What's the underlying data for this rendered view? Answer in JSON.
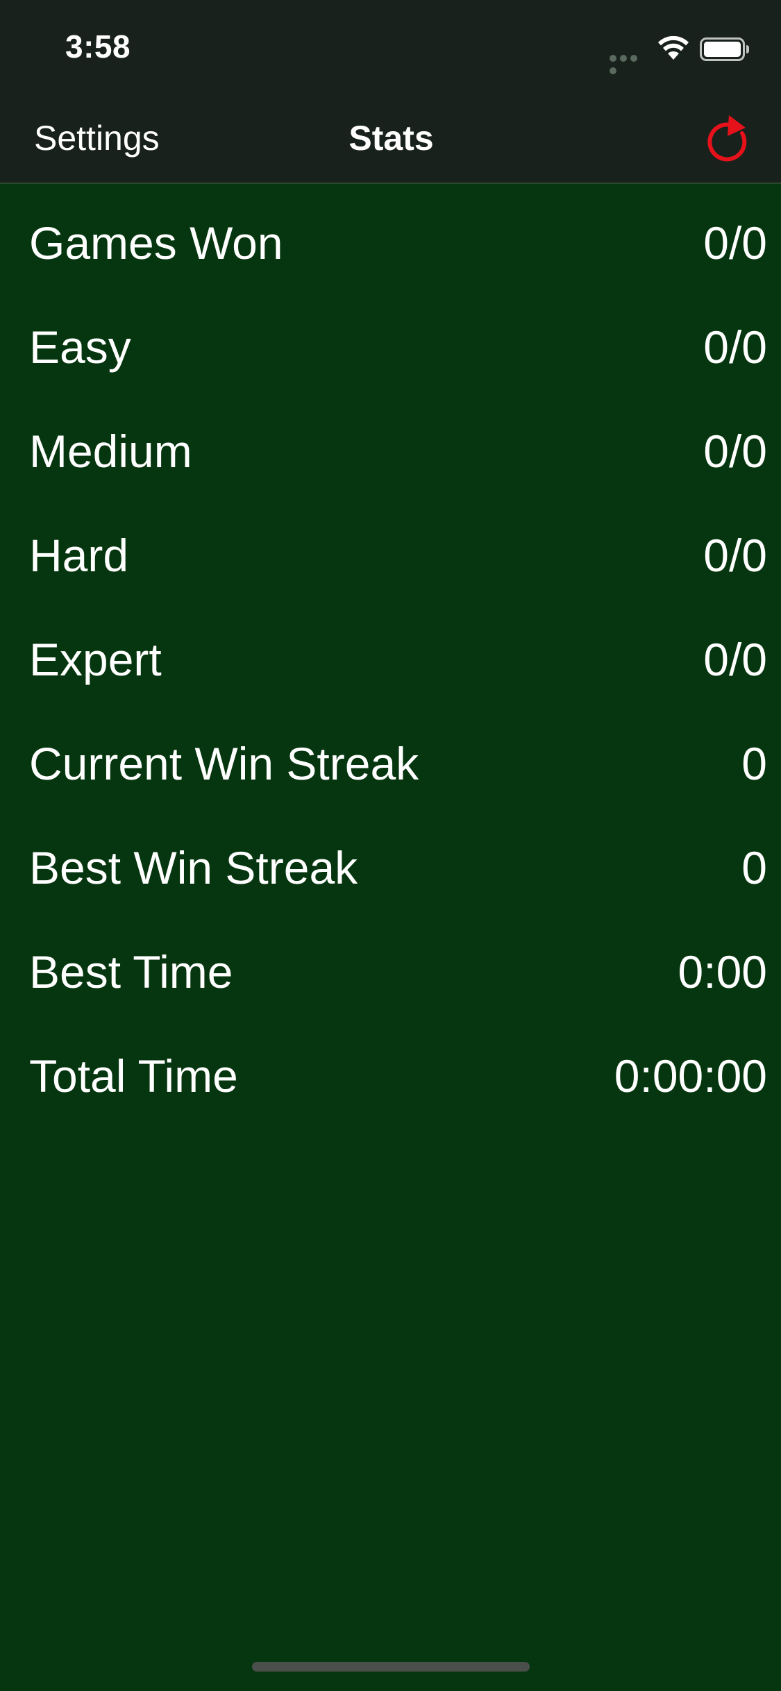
{
  "status_bar": {
    "time": "3:58"
  },
  "nav": {
    "left_label": "Settings",
    "title": "Stats",
    "reset_icon": "reset-arrow-icon",
    "accent_color": "#e5121c"
  },
  "stats": [
    {
      "label": "Games Won",
      "value": "0/0"
    },
    {
      "label": "Easy",
      "value": "0/0"
    },
    {
      "label": "Medium",
      "value": "0/0"
    },
    {
      "label": "Hard",
      "value": "0/0"
    },
    {
      "label": "Expert",
      "value": "0/0"
    },
    {
      "label": "Current Win Streak",
      "value": "0"
    },
    {
      "label": "Best Win Streak",
      "value": "0"
    },
    {
      "label": "Best Time",
      "value": "0:00"
    },
    {
      "label": "Total Time",
      "value": "0:00:00"
    }
  ],
  "colors": {
    "background": "#06360f",
    "bar_background": "#18211b"
  }
}
